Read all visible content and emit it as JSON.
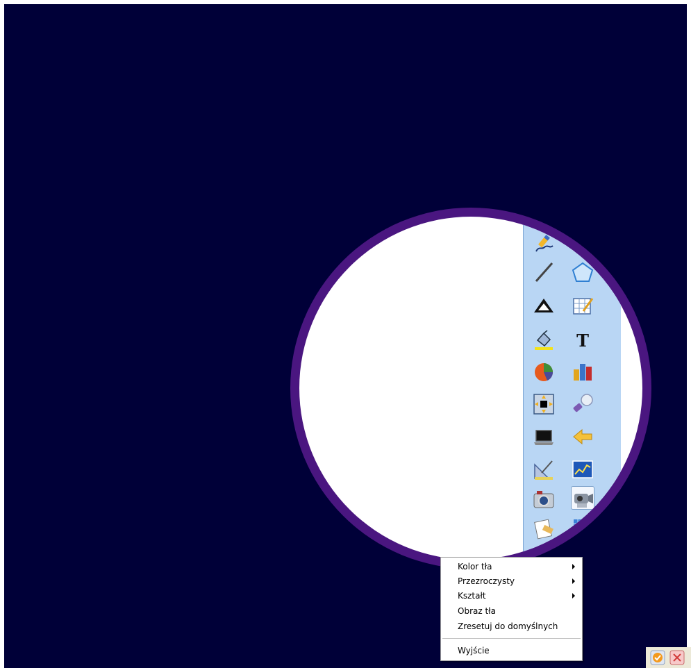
{
  "colors": {
    "desktop_background": "#000038",
    "spotlight_ring": "#4a1680",
    "spotlight_fill": "#ffffff",
    "toolbar": "#b9d6f4"
  },
  "toolbar": {
    "tools": [
      {
        "icon": "pen-icon"
      },
      {
        "icon": "line-icon"
      },
      {
        "icon": "pentagon-icon"
      },
      {
        "icon": "triangle-ruler-icon"
      },
      {
        "icon": "edit-table-icon"
      },
      {
        "icon": "fill-bucket-icon"
      },
      {
        "icon": "text-icon"
      },
      {
        "icon": "pie-chart-icon"
      },
      {
        "icon": "bar-chart-icon"
      },
      {
        "icon": "screen-shade-icon"
      },
      {
        "icon": "spotlight-icon",
        "selected": true
      },
      {
        "icon": "laptop-icon"
      },
      {
        "icon": "back-arrow-icon"
      },
      {
        "icon": "geometry-tools-icon"
      },
      {
        "icon": "line-graph-icon"
      },
      {
        "icon": "camera-icon"
      },
      {
        "icon": "video-camera-icon"
      },
      {
        "icon": "notes-icon"
      },
      {
        "icon": "grid-icon"
      },
      {
        "icon": "green-tool-icon"
      }
    ]
  },
  "context_menu": {
    "items": [
      {
        "label": "Kolor tła",
        "submenu": true
      },
      {
        "label": "Przezroczysty",
        "submenu": true
      },
      {
        "label": "Kształt",
        "submenu": true
      },
      {
        "label": "Obraz tła",
        "submenu": false
      },
      {
        "label": "Zresetuj do domyślnych",
        "submenu": false
      },
      {
        "label": "Wyjście",
        "submenu": false
      }
    ]
  },
  "corner_buttons": [
    {
      "icon": "orange-check-icon"
    },
    {
      "icon": "close-icon"
    }
  ]
}
